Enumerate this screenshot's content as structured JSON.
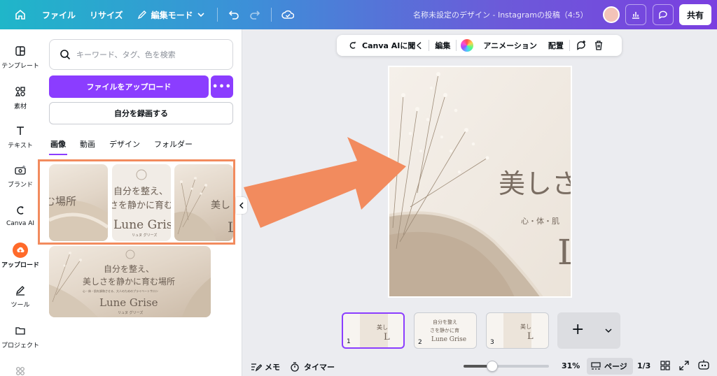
{
  "topbar": {
    "file": "ファイル",
    "resize": "リサイズ",
    "edit_mode": "編集モード",
    "title": "名称未設定のデザイン - Instagramの投稿（4:5）",
    "share": "共有"
  },
  "rail": {
    "items": [
      {
        "label": "テンプレート",
        "icon": "template-icon"
      },
      {
        "label": "素材",
        "icon": "elements-icon"
      },
      {
        "label": "テキスト",
        "icon": "text-icon"
      },
      {
        "label": "ブランド",
        "icon": "brand-icon"
      },
      {
        "label": "Canva AI",
        "icon": "canva-ai-icon"
      },
      {
        "label": "アップロード",
        "icon": "upload-icon"
      },
      {
        "label": "ツール",
        "icon": "tools-icon"
      },
      {
        "label": "プロジェクト",
        "icon": "folder-icon"
      }
    ]
  },
  "panel": {
    "search_placeholder": "キーワード、タグ、色を検索",
    "upload_button": "ファイルをアップロード",
    "more_button": "•••",
    "record_button": "自分を録画する",
    "tabs": [
      "画像",
      "動画",
      "デザイン",
      "フォルダー"
    ],
    "thumb1": {
      "line1": "む場所"
    },
    "thumb2": {
      "line1": "自分を整え、",
      "line2": "さを静かに育む",
      "brand": "Lune Grise",
      "kana": "リュヌ グリーズ"
    },
    "thumb3": {
      "line1": "美し",
      "big": "L"
    },
    "wide": {
      "line1": "自分を整え、",
      "line2": "美しさを静かに育む場所",
      "line3": "心・体・肌を調和させる、大人のためのプライベートサロン",
      "brand": "Lune Grise",
      "kana": "リュヌ グリーズ"
    }
  },
  "context_toolbar": {
    "ask_ai": "Canva AIに聞く",
    "edit": "編集",
    "animation": "アニメーション",
    "arrange": "配置"
  },
  "canvas": {
    "title": "美しさ",
    "subtitle": "心・体・肌",
    "big_letter": "L"
  },
  "pages": {
    "items": [
      {
        "num": "1",
        "line1": "美し",
        "big": "L"
      },
      {
        "num": "2",
        "line1": "自分を整え",
        "line2": "さを静かに育",
        "brand": "Lune Grise"
      },
      {
        "num": "3",
        "line1": "美し",
        "big": "L"
      }
    ],
    "add": "+"
  },
  "bottombar": {
    "notes": "メモ",
    "timer": "タイマー",
    "zoom": "31%",
    "zoom_fraction": 0.31,
    "pages_button": "ページ",
    "page_count": "1/3"
  },
  "colors": {
    "accent": "#8b3dff",
    "highlight": "#f28b5e",
    "upload_orange": "#ff6a2a"
  }
}
